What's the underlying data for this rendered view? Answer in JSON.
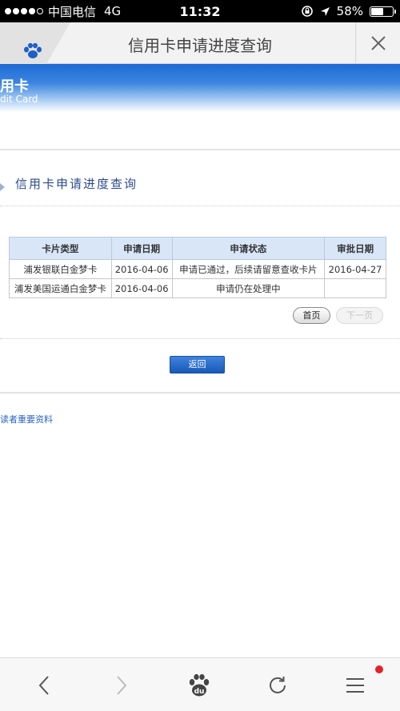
{
  "status_bar": {
    "carrier": "中国电信",
    "network": "4G",
    "time": "11:32",
    "battery": "58%",
    "battery_level": 0.58
  },
  "title_bar": {
    "title": "信用卡申请进度查询",
    "app_icon": "baidu-paw-icon",
    "close_icon": "close-icon"
  },
  "banner": {
    "title_cn": "用卡",
    "title_en": "dit Card"
  },
  "section": {
    "title": "信用卡申请进度查询"
  },
  "table": {
    "headers": [
      "卡片类型",
      "申请日期",
      "申请状态",
      "审批日期"
    ],
    "rows": [
      [
        "浦发银联白金梦卡",
        "2016-04-06",
        "申请已通过，后续请留意查收卡片",
        "2016-04-27"
      ],
      [
        "浦发美国运通白金梦卡",
        "2016-04-06",
        "申请仍在处理中",
        ""
      ]
    ]
  },
  "pager": {
    "first": "首页",
    "next": "下一页"
  },
  "back_button": "返回",
  "link_text": "读者重要资料",
  "toolbar": {
    "icons": [
      "back-icon",
      "forward-icon",
      "baidu-home-icon",
      "refresh-icon",
      "menu-icon"
    ]
  },
  "colors": {
    "banner_blue": "#1e6ad4",
    "section_title": "#2b4c8c",
    "button_blue": "#1959b8",
    "badge_red": "#e0242a"
  }
}
